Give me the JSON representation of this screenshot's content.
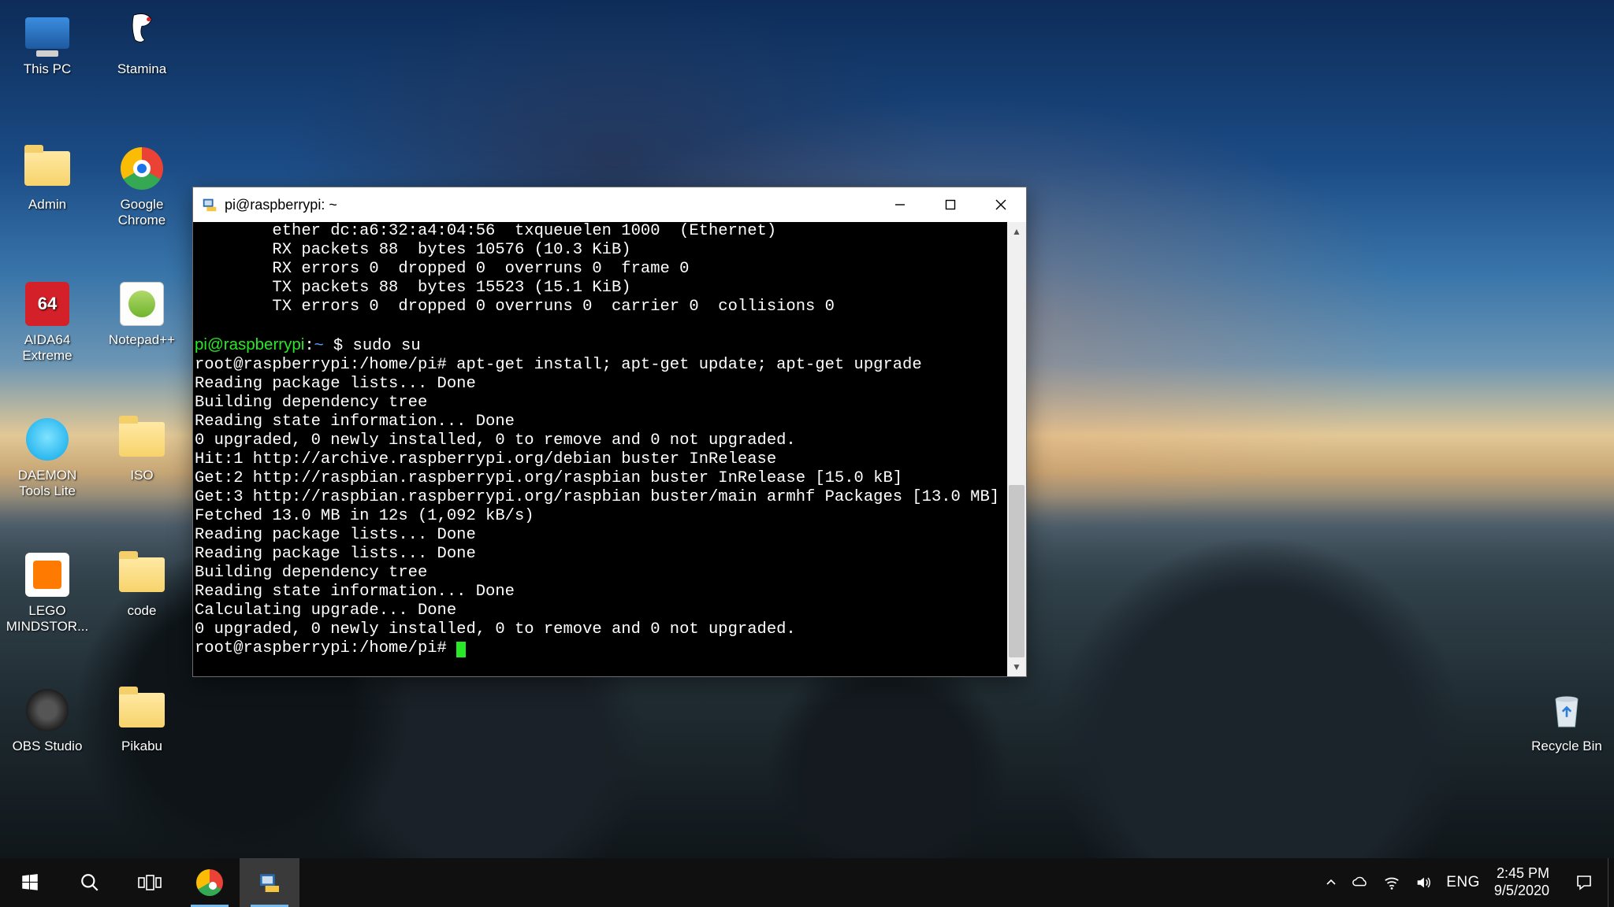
{
  "desktop": {
    "icons": {
      "this_pc": {
        "label": "This PC"
      },
      "stamina": {
        "label": "Stamina"
      },
      "admin": {
        "label": "Admin"
      },
      "chrome": {
        "label": "Google",
        "label2": "Chrome"
      },
      "aida64": {
        "label": "AIDA64",
        "label2": "Extreme",
        "badge": "64"
      },
      "nppp": {
        "label": "Notepad++"
      },
      "daemon": {
        "label": "DAEMON",
        "label2": "Tools Lite"
      },
      "iso": {
        "label": "ISO"
      },
      "lego": {
        "label": "LEGO",
        "label2": "MINDSTOR..."
      },
      "code": {
        "label": "code"
      },
      "obs": {
        "label": "OBS Studio"
      },
      "pikabu": {
        "label": "Pikabu"
      },
      "recycle": {
        "label": "Recycle Bin"
      }
    }
  },
  "window": {
    "title": "pi@raspberrypi: ~",
    "terminal": {
      "pre_lines": [
        "        ether dc:a6:32:a4:04:56  txqueuelen 1000  (Ethernet)",
        "        RX packets 88  bytes 10576 (10.3 KiB)",
        "        RX errors 0  dropped 0  overruns 0  frame 0",
        "        TX packets 88  bytes 15523 (15.1 KiB)",
        "        TX errors 0  dropped 0 overruns 0  carrier 0  collisions 0",
        ""
      ],
      "p1_user": "pi@raspberrypi",
      "p1_sep": ":",
      "p1_path": "~",
      "p1_suffix": " $ ",
      "p1_cmd": "sudo su",
      "p2_prompt": "root@raspberrypi:/home/pi# ",
      "p2_cmd": "apt-get install; apt-get update; apt-get upgrade",
      "mid_lines": [
        "Reading package lists... Done",
        "Building dependency tree",
        "Reading state information... Done",
        "0 upgraded, 0 newly installed, 0 to remove and 0 not upgraded.",
        "Hit:1 http://archive.raspberrypi.org/debian buster InRelease",
        "Get:2 http://raspbian.raspberrypi.org/raspbian buster InRelease [15.0 kB]",
        "Get:3 http://raspbian.raspberrypi.org/raspbian buster/main armhf Packages [13.0 MB]",
        "Fetched 13.0 MB in 12s (1,092 kB/s)",
        "Reading package lists... Done",
        "Reading package lists... Done",
        "Building dependency tree",
        "Reading state information... Done",
        "Calculating upgrade... Done",
        "0 upgraded, 0 newly installed, 0 to remove and 0 not upgraded."
      ],
      "p3_prompt": "root@raspberrypi:/home/pi# "
    }
  },
  "taskbar": {
    "lang": "ENG",
    "time": "2:45 PM",
    "date": "9/5/2020"
  }
}
